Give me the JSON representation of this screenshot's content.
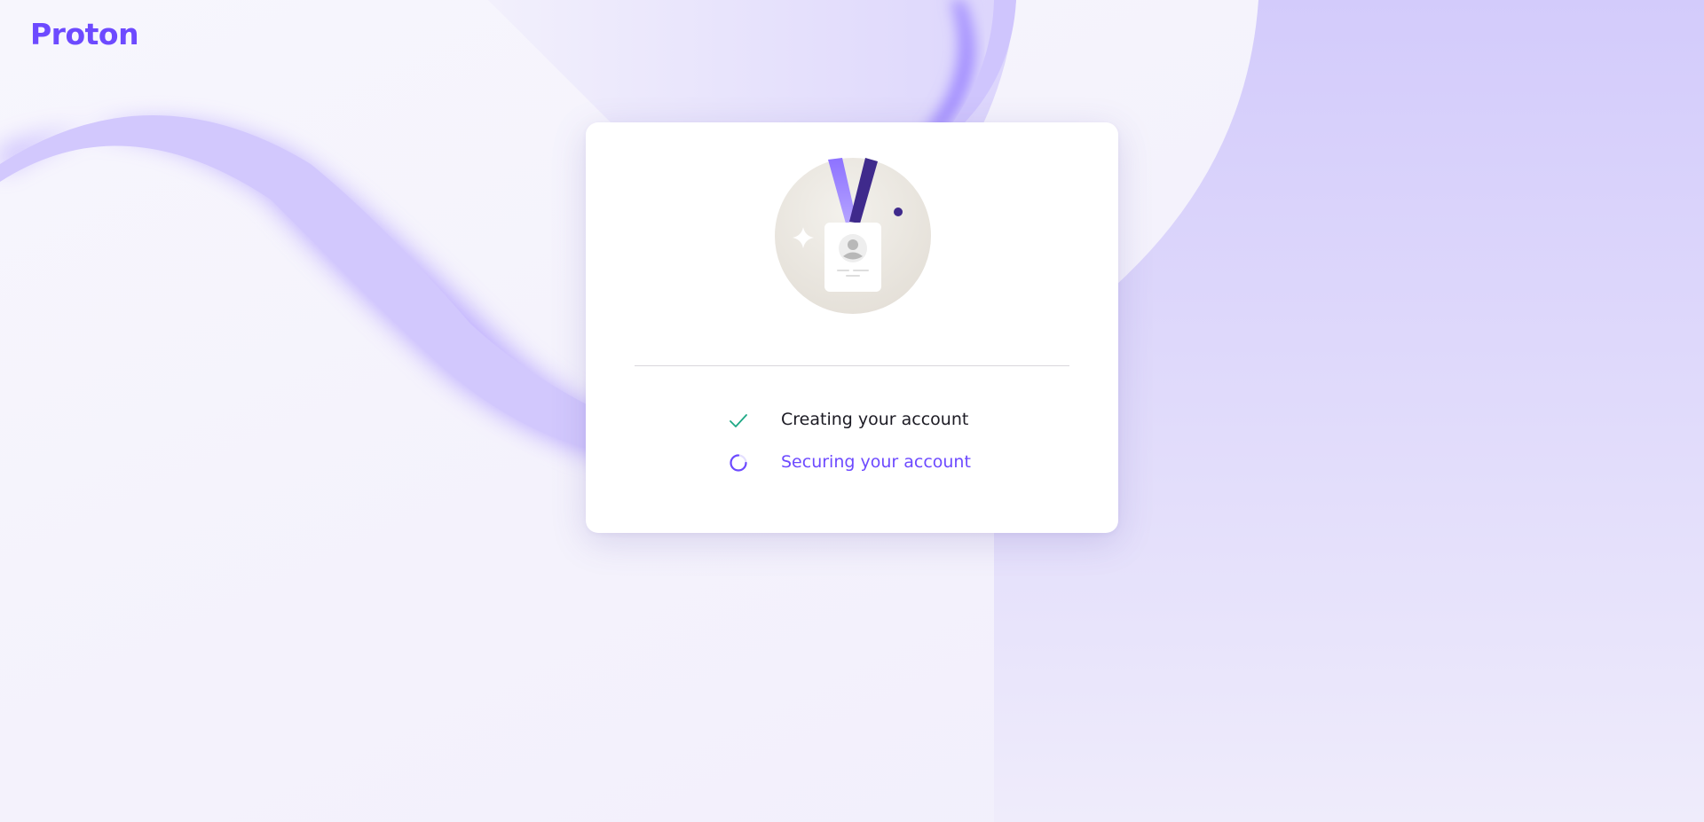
{
  "brand": {
    "name": "Proton"
  },
  "progress": {
    "steps": [
      {
        "label": "Creating your account",
        "status": "done",
        "icon": "check-icon"
      },
      {
        "label": "Securing your account",
        "status": "in-progress",
        "icon": "spinner-icon"
      }
    ]
  },
  "colors": {
    "accent": "#6d4aff",
    "success": "#1ea885",
    "text": "#1c1b24",
    "background": "#f6f4fd"
  }
}
